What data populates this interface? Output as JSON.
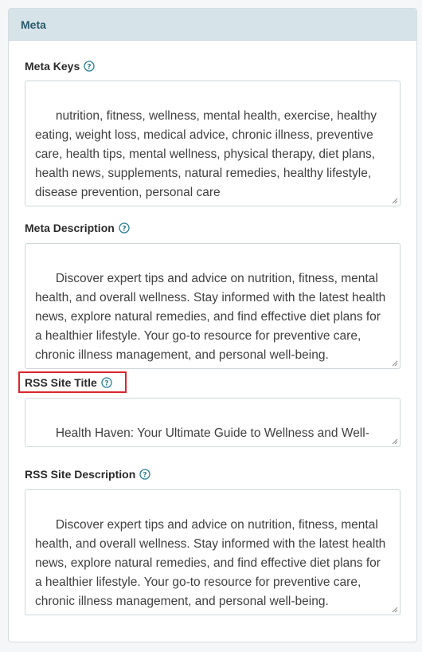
{
  "panel": {
    "title": "Meta"
  },
  "fields": {
    "meta_keys": {
      "label": "Meta Keys",
      "value": "nutrition, fitness, wellness, mental health, exercise, healthy eating, weight loss, medical advice, chronic illness, preventive care, health tips, mental wellness, physical therapy, diet plans, health news, supplements, natural remedies, healthy lifestyle, disease prevention, personal care"
    },
    "meta_description": {
      "label": "Meta Description",
      "value": "Discover expert tips and advice on nutrition, fitness, mental health, and overall wellness. Stay informed with the latest health news, explore natural remedies, and find effective diet plans for a healthier lifestyle. Your go-to resource for preventive care, chronic illness management, and personal well-being."
    },
    "rss_site_title": {
      "label": "RSS Site Title",
      "value": "Health Haven: Your Ultimate Guide to Wellness and Well-Being"
    },
    "rss_site_description": {
      "label": "RSS Site Description",
      "value": "Discover expert tips and advice on nutrition, fitness, mental health, and overall wellness. Stay informed with the latest health news, explore natural remedies, and find effective diet plans for a healthier lifestyle. Your go-to resource for preventive care, chronic illness management, and personal well-being."
    }
  },
  "icons": {
    "help": "question-circle-icon",
    "resize": "resize-grip-icon"
  },
  "colors": {
    "accent": "#2a7f94",
    "highlight": "#d9262e",
    "header_bg": "#d6e3e8"
  }
}
